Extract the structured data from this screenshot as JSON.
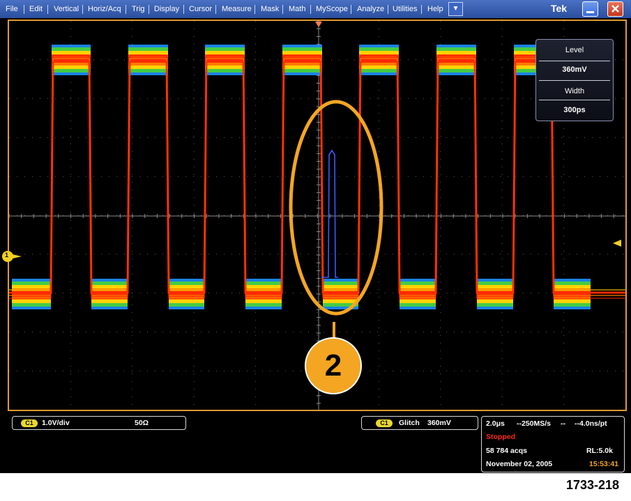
{
  "menubar": {
    "items": [
      "File",
      "Edit",
      "Vertical",
      "Horiz/Acq",
      "Trig",
      "Display",
      "Cursor",
      "Measure",
      "Mask",
      "Math",
      "MyScope",
      "Analyze",
      "Utilities",
      "Help"
    ],
    "dropdown_glyph": "▼",
    "brand": "Tek",
    "minimize_icon": "minimize-icon",
    "close_icon": "close-icon"
  },
  "waveform": {
    "channel_marker": "1",
    "persistence_colors": [
      "#ff2a00",
      "#ff7a00",
      "#ffd200",
      "#44cc44",
      "#1e90ff"
    ],
    "glitch_color": "#3a5bff",
    "trace_count": 7
  },
  "trigger_panel": {
    "level_label": "Level",
    "level_value": "360mV",
    "width_label": "Width",
    "width_value": "300ps"
  },
  "callout": {
    "number": "2"
  },
  "channel_readout": {
    "badge": "C1",
    "scale": "1.0V/div",
    "impedance": "50Ω"
  },
  "trigger_readout": {
    "badge": "C1",
    "type": "Glitch",
    "level": "360mV"
  },
  "acquisition": {
    "timebase": "2.0μs",
    "sample_rate": "--250MS/s",
    "separator": "--",
    "resolution": "--4.0ns/pt",
    "status": "Stopped",
    "acqs": "58 784 acqs",
    "record_length": "RL:5.0k",
    "date": "November 02, 2005",
    "time": "15:53:41"
  },
  "figure_id": "1733-218"
}
